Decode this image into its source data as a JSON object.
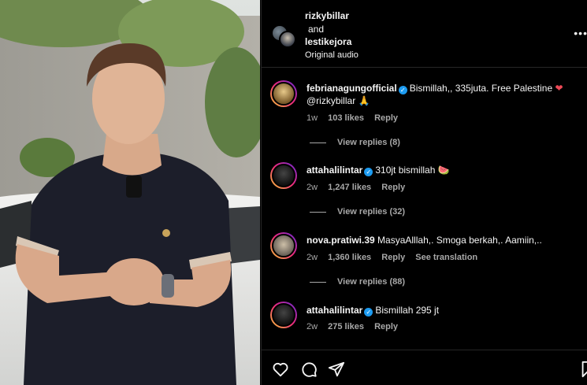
{
  "header": {
    "user1": "rizkybillar",
    "and_text": "and",
    "user2": "lestikejora",
    "audio": "Original audio",
    "more": "•••"
  },
  "comments": [
    {
      "user": "febrianagungofficial",
      "text": "Bismillah,, 335juta. Free Palestine",
      "mention": "@rizkybillar",
      "time": "1w",
      "likes": "103 likes",
      "reply": "Reply",
      "view_replies": "View replies (8)"
    },
    {
      "user": "attahalilintar",
      "text": "310jt bismillah",
      "time": "2w",
      "likes": "1,247 likes",
      "reply": "Reply",
      "view_replies": "View replies (32)"
    },
    {
      "user": "nova.pratiwi.39",
      "text": "MasyaAlllah,. Smoga berkah,. Aamiin,..",
      "time": "2w",
      "likes": "1,360 likes",
      "reply": "Reply",
      "translate": "See translation",
      "view_replies": "View replies (88)"
    },
    {
      "user": "attahalilintar",
      "text": "Bismillah 295 jt",
      "time": "2w",
      "likes": "275 likes",
      "reply": "Reply"
    }
  ],
  "icons": [
    "heart-icon",
    "comment-icon",
    "share-icon",
    "bookmark-icon"
  ]
}
